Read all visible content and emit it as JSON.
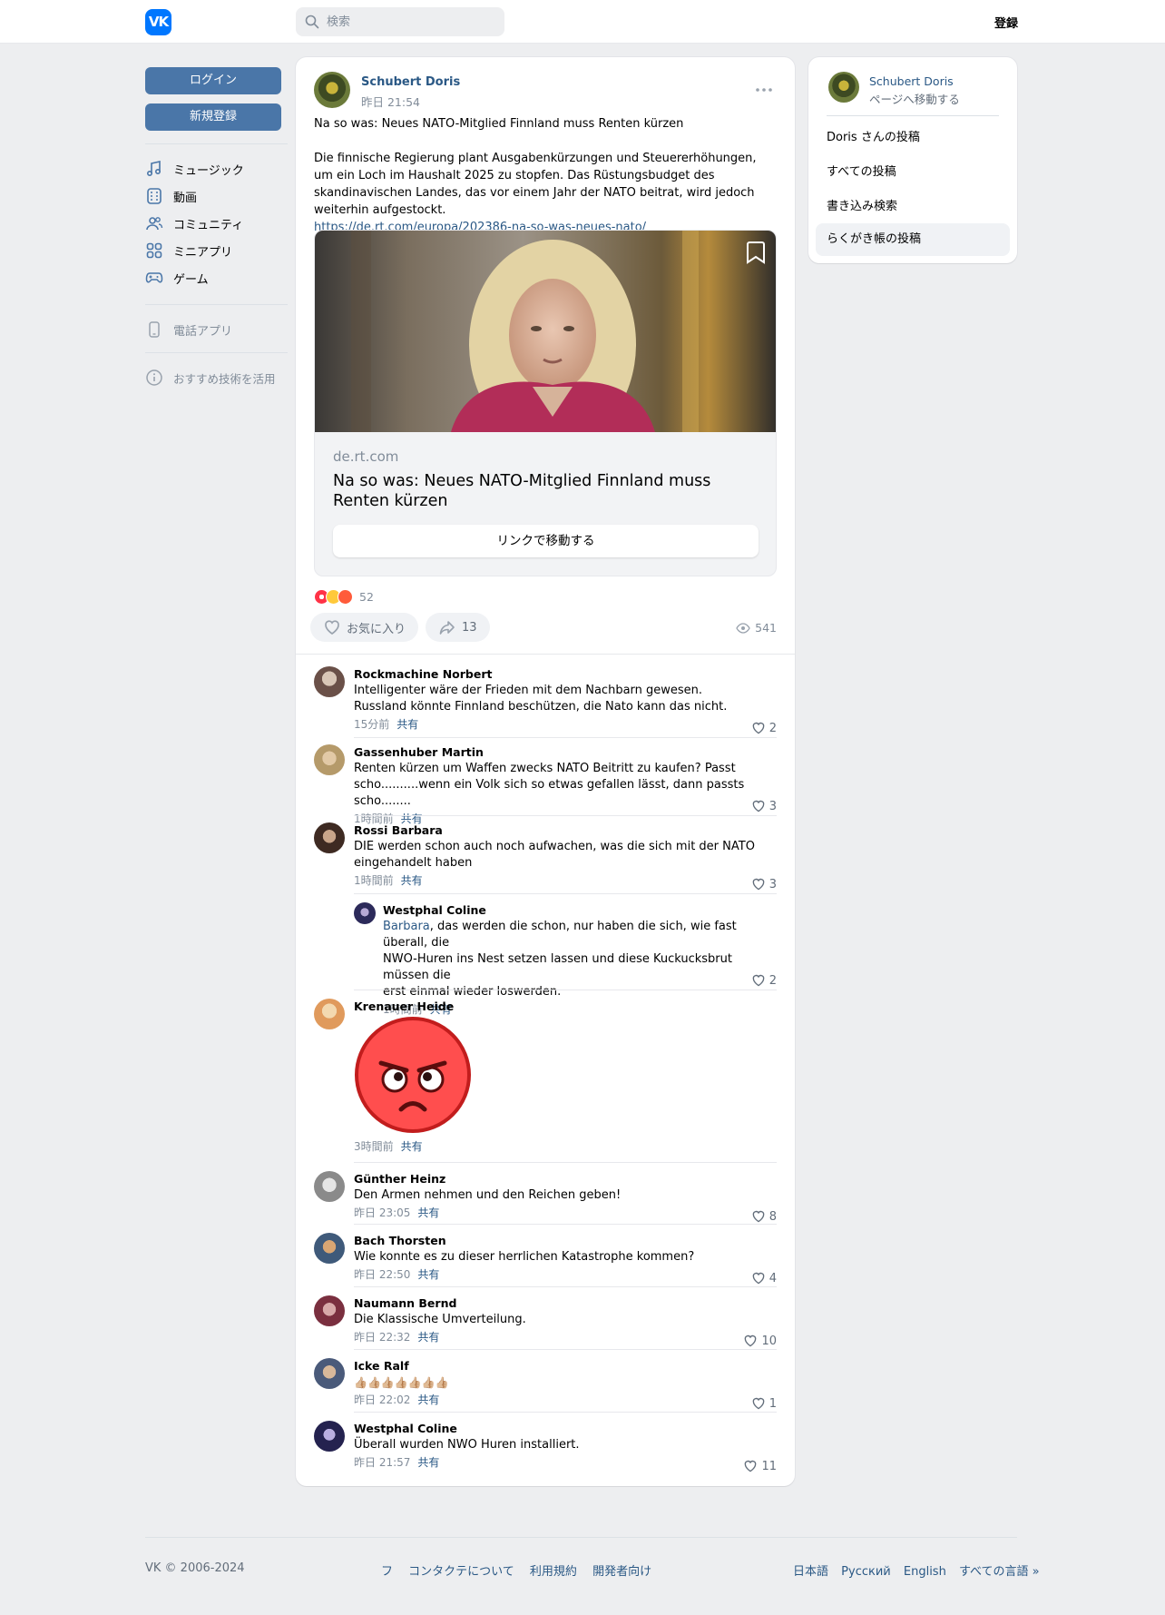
{
  "header": {
    "logo": "VK",
    "search_placeholder": "検索",
    "register_link": "登録"
  },
  "left_nav": {
    "login_button": "ログイン",
    "signup_button": "新規登録",
    "items": [
      {
        "label": "ミュージック",
        "icon": "music-icon"
      },
      {
        "label": "動画",
        "icon": "video-icon"
      },
      {
        "label": "コミュニティ",
        "icon": "community-icon"
      },
      {
        "label": "ミニアプリ",
        "icon": "apps-icon"
      },
      {
        "label": "ゲーム",
        "icon": "gamepad-icon"
      }
    ],
    "phone_app": "電話アプリ",
    "recommend_tech": "おすすめ技術を活用"
  },
  "post": {
    "author": "Schubert Doris",
    "time": "昨日 21:54",
    "headline": "Na so was: Neues NATO-Mitglied Finnland muss Renten kürzen",
    "body": "Die finnische Regierung plant Ausgabenkürzungen und Steuererhöhungen, um ein Loch im Haushalt 2025 zu stopfen. Das Rüstungsbudget des skandinavischen Landes, das vor einem Jahr der NATO beitrat, wird jedoch weiterhin aufgestockt.",
    "link": "https://de.rt.com/europa/202386-na-so-was-neues-nato/",
    "attachment": {
      "domain": "de.rt.com",
      "title": "Na so was: Neues NATO-Mitglied Finnland muss Renten kürzen",
      "button": "リンクで移動する"
    },
    "reactions_count": "52",
    "like_label": "お気に入り",
    "share_count": "13",
    "views": "541",
    "colors": {
      "link": "#2a5885",
      "primary": "#4a76a8"
    }
  },
  "comments": [
    {
      "name": "Rockmachine Norbert",
      "lines": [
        "Intelligenter wäre der Frieden mit dem Nachbarn gewesen.",
        "Russland könnte Finnland beschützen, die Nato kann das nicht."
      ],
      "time": "15分前",
      "share": "共有",
      "likes": "2"
    },
    {
      "name": "Gassenhuber Martin",
      "lines": [
        "Renten kürzen um Waffen zwecks NATO Beitritt zu kaufen? Passt",
        "scho..........wenn ein Volk sich so etwas gefallen lässt, dann passts scho........"
      ],
      "time": "1時間前",
      "share": "共有",
      "likes": "3"
    },
    {
      "name": "Rossi Barbara",
      "lines": [
        "DIE werden schon auch noch aufwachen, was die sich mit der NATO",
        "eingehandelt haben"
      ],
      "time": "1時間前",
      "share": "共有",
      "likes": "3"
    },
    {
      "name": "Westphal Coline",
      "reply_to": "Barbara",
      "lines": [
        ", das werden die schon, nur haben die sich, wie fast überall, die",
        "NWO-Huren ins Nest setzen lassen und diese Kuckucksbrut müssen die",
        "erst einmal wieder loswerden."
      ],
      "time": "1時間前",
      "share": "共有",
      "likes": "2"
    },
    {
      "name": "Krenauer Heide",
      "sticker": "angry-face-sticker",
      "time": "3時間前",
      "share": "共有"
    },
    {
      "name": "Günther Heinz",
      "lines": [
        "Den Armen nehmen und den Reichen geben!"
      ],
      "time": "昨日 23:05",
      "share": "共有",
      "likes": "8"
    },
    {
      "name": "Bach Thorsten",
      "lines": [
        "Wie konnte es zu dieser herrlichen Katastrophe kommen?"
      ],
      "time": "昨日 22:50",
      "share": "共有",
      "likes": "4"
    },
    {
      "name": "Naumann Bernd",
      "lines": [
        "Die Klassische Umverteilung."
      ],
      "time": "昨日 22:32",
      "share": "共有",
      "likes": "10"
    },
    {
      "name": "Icke Ralf",
      "lines": [
        "👍🏼👍🏼👍🏼👍🏼👍🏼👍🏼👍🏼"
      ],
      "time": "昨日 22:02",
      "share": "共有",
      "likes": "1"
    },
    {
      "name": "Westphal Coline",
      "lines": [
        "Überall wurden NWO Huren installiert."
      ],
      "time": "昨日 21:57",
      "share": "共有",
      "likes": "11"
    }
  ],
  "side": {
    "name": "Schubert Doris",
    "sub": "ページへ移動する",
    "items": [
      "Doris さんの投稿",
      "すべての投稿",
      "書き込み検索",
      "らくがき帳の投稿"
    ]
  },
  "footer": {
    "copyright": "VK © 2006-2024",
    "links": [
      "フ",
      "コンタクテについて",
      "利用規約",
      "開発者向け"
    ],
    "langs": [
      "日本語",
      "Русский",
      "English",
      "すべての言語 »"
    ]
  }
}
